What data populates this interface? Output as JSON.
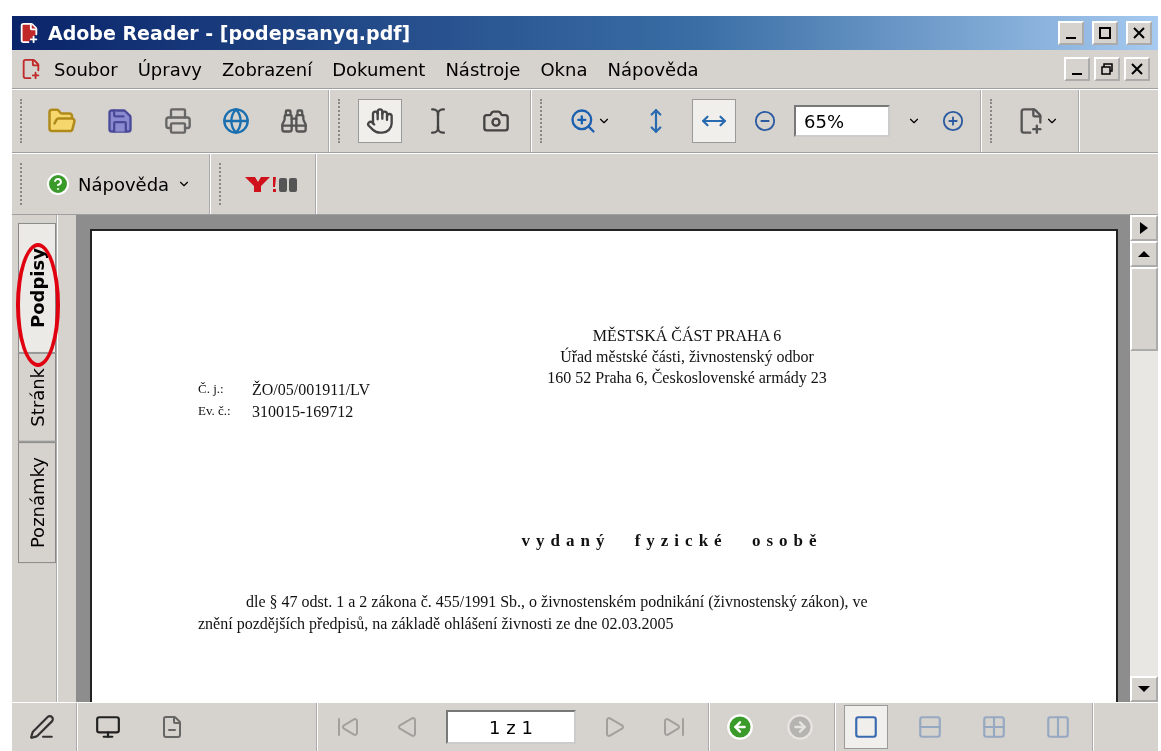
{
  "window": {
    "title": "Adobe Reader - [podepsanyq.pdf]"
  },
  "menu": [
    "Soubor",
    "Úpravy",
    "Zobrazení",
    "Dokument",
    "Nástroje",
    "Okna",
    "Nápověda"
  ],
  "toolbar": {
    "tools": [
      {
        "selected": true
      },
      {
        "selected": false
      },
      {
        "selected": false
      }
    ],
    "fit_buttons": [
      {
        "selected": false
      },
      {
        "selected": true
      }
    ],
    "zoom": {
      "value": "65%"
    }
  },
  "toolbar2": {
    "help_button": "Nápověda"
  },
  "side_tabs": [
    {
      "label": "Podpisy",
      "selected": true
    },
    {
      "label": "Stránk",
      "selected": false
    },
    {
      "label": "Poznámky",
      "selected": false
    }
  ],
  "document": {
    "header": [
      "MĚSTSKÁ ČÁST PRAHA 6",
      "Úřad městské části, živnostenský odbor",
      "160 52 Praha 6, Československé armády 23"
    ],
    "refs": [
      {
        "label": "Č. j.:",
        "value": "ŽO/05/001911/LV"
      },
      {
        "label": "Ev. č.:",
        "value": "310015-169712"
      }
    ],
    "heading": "vydaný fyzické osobě",
    "paragraph_lines": [
      "dle § 47 odst. 1 a 2 zákona č. 455/1991 Sb., o živnostenském podnikání (živnostenský zákon), ve",
      "znění pozdějších předpisů, na základě ohlášení živnosti ze dne 02.03.2005"
    ]
  },
  "status_bar": {
    "page_field": {
      "value": "1 z 1"
    },
    "nav_buttons": [
      {
        "disabled": true
      },
      {
        "disabled": true
      },
      {
        "disabled": true
      },
      {
        "disabled": true
      }
    ],
    "history": [
      {
        "disabled": false
      },
      {
        "disabled": true
      }
    ],
    "layouts": [
      {
        "selected": true
      },
      {
        "selected": false
      },
      {
        "selected": false
      },
      {
        "selected": false
      }
    ]
  }
}
